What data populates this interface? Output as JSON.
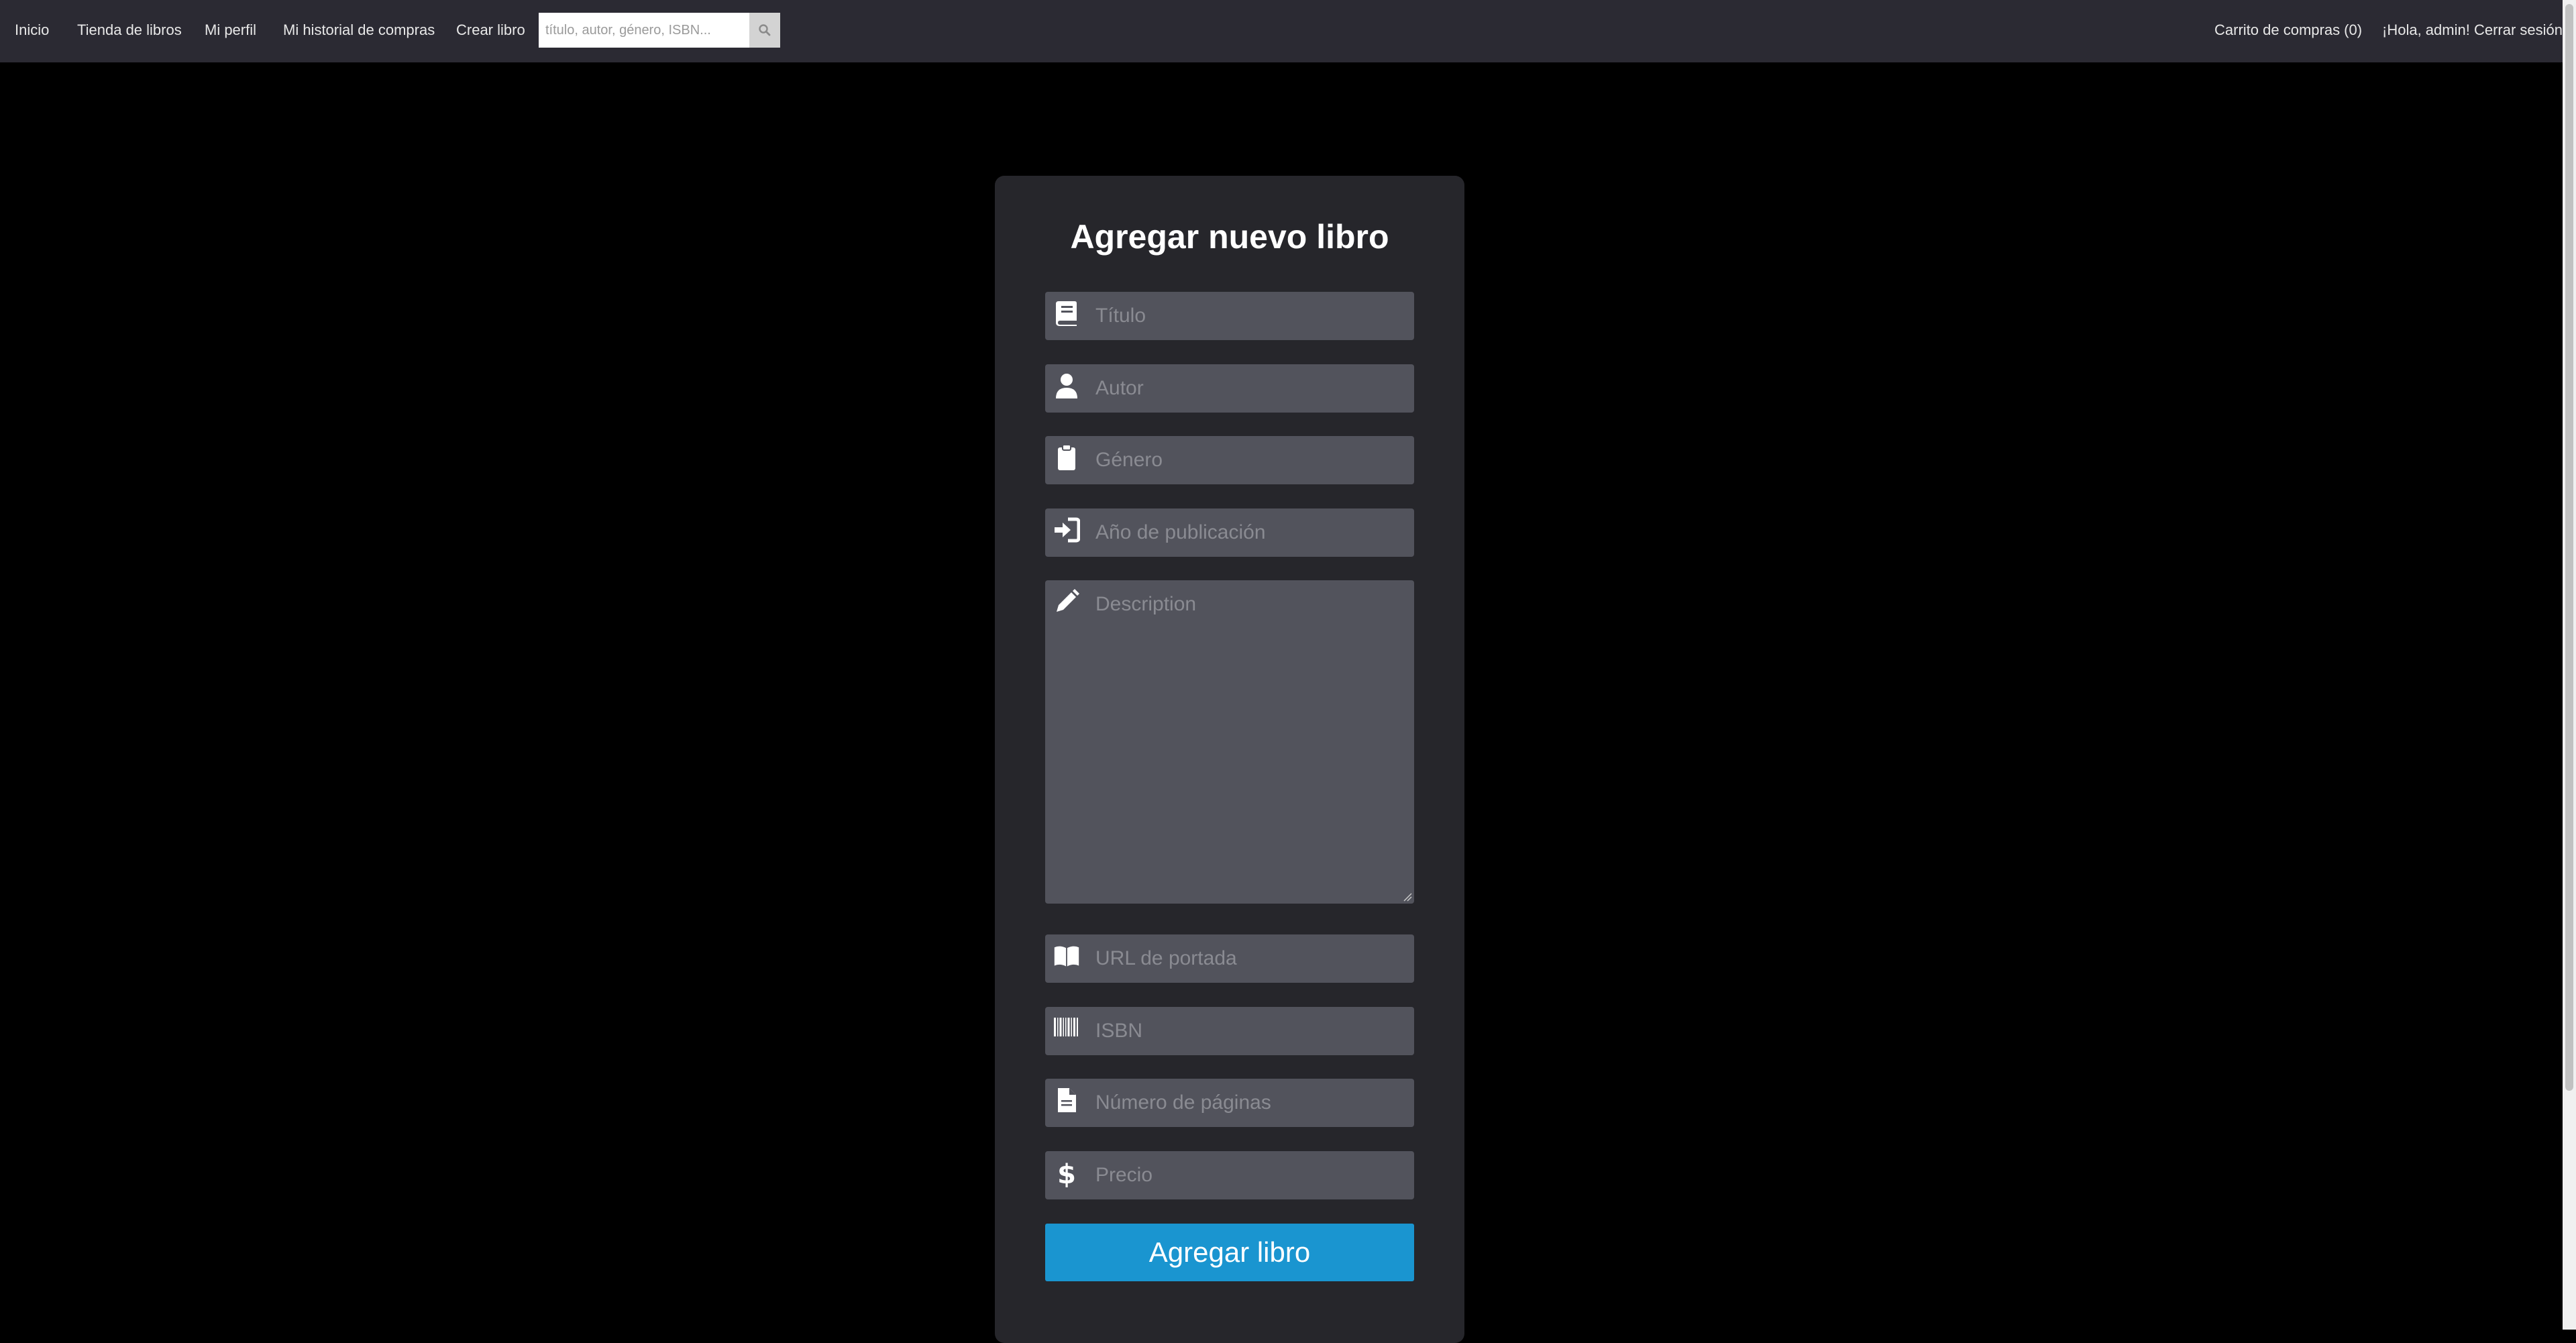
{
  "navbar": {
    "links": [
      "Inicio",
      "Tienda de libros",
      "Mi perfil",
      "Mi historial de compras",
      "Crear libro"
    ],
    "search_placeholder": "título, autor, género, ISBN...",
    "cart": "Carrito de compras (0)",
    "greeting": "¡Hola, admin! Cerrar sesión"
  },
  "form": {
    "title": "Agregar nuevo libro",
    "fields": {
      "title": "Título",
      "author": "Autor",
      "genre": "Género",
      "year": "Año de publicación",
      "description": "Description",
      "cover": "URL de portada",
      "isbn": "ISBN",
      "pages": "Número de páginas",
      "price": "Precio"
    },
    "submit": "Agregar libro"
  },
  "icons": [
    "book-icon",
    "user-icon",
    "clipboard-icon",
    "sign-in-icon",
    "pencil-icon",
    "open-book-icon",
    "barcode-icon",
    "file-icon",
    "dollar-icon",
    "search-icon"
  ]
}
